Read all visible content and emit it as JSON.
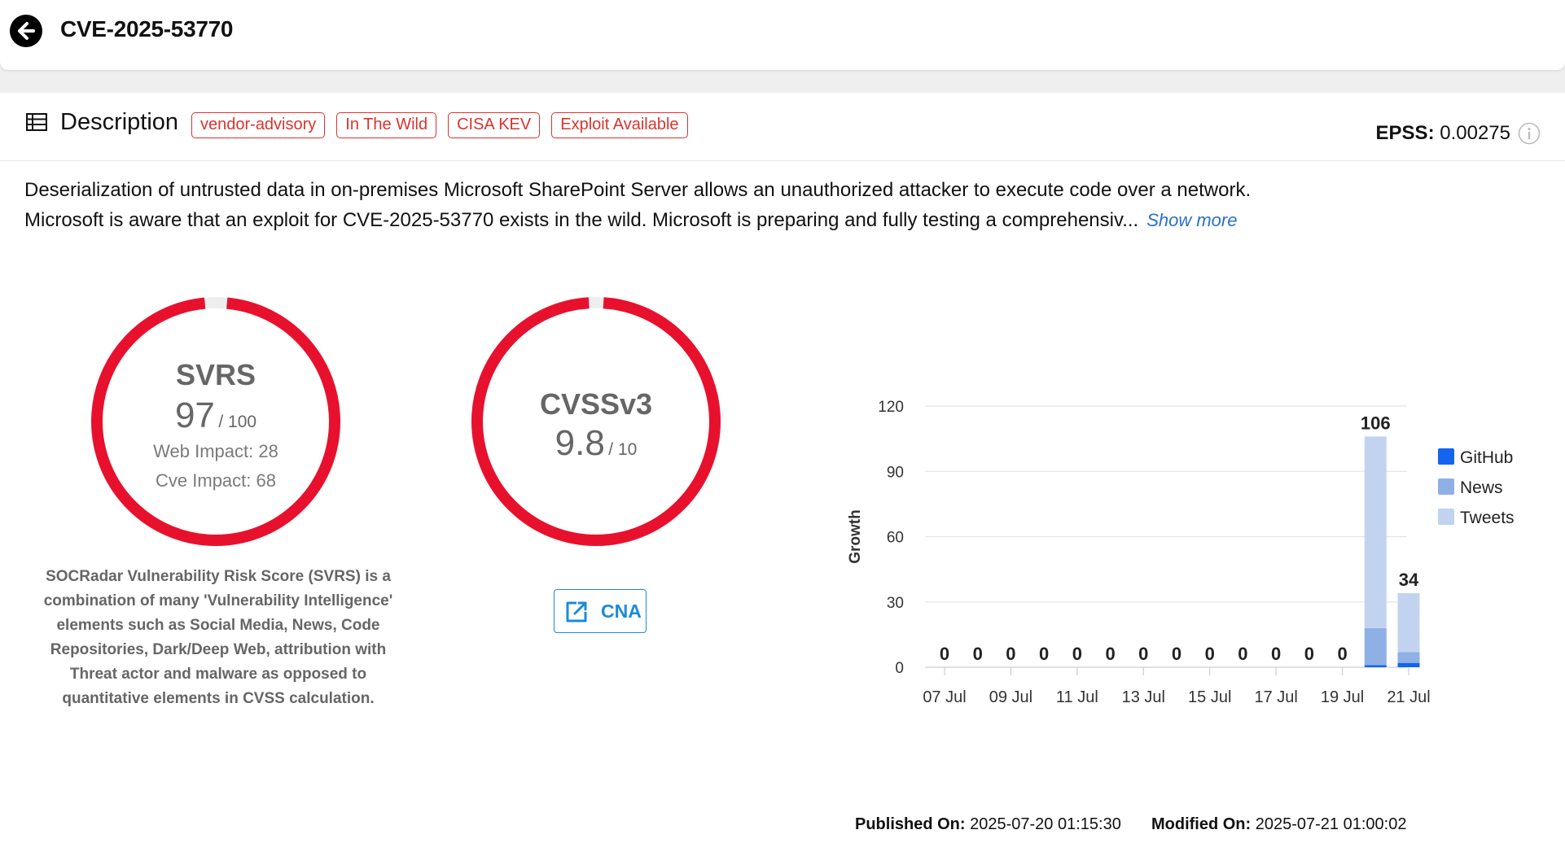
{
  "header": {
    "title": "CVE-2025-53770",
    "back_icon": "arrow-left-icon"
  },
  "description": {
    "heading": "Description",
    "tags": [
      "vendor-advisory",
      "In The Wild",
      "CISA KEV",
      "Exploit Available"
    ],
    "epss_label": "EPSS:",
    "epss_value": "0.00275",
    "text": "Deserialization of untrusted data in on-premises Microsoft SharePoint Server allows an unauthorized attacker to execute code over a network. Microsoft is aware that an exploit for CVE-2025-53770 exists in the wild. Microsoft is preparing and fully testing a comprehensiv...",
    "show_more": "Show more"
  },
  "svrs": {
    "title": "SVRS",
    "score": "97",
    "max": "/ 100",
    "fraction": 0.97,
    "web_impact": "Web Impact: 28",
    "cve_impact": "Cve Impact: 68",
    "note": "SOCRadar Vulnerability Risk Score (SVRS) is a combination of many 'Vulnerability Intelligence' elements such as Social Media, News, Code Repositories, Dark/Deep Web, attribution with Threat actor and malware as opposed to quantitative elements in CVSS calculation."
  },
  "cvss": {
    "title": "CVSSv3",
    "score": "9.8",
    "max": "/ 10",
    "fraction": 0.98,
    "cna_label": "CNA"
  },
  "colors": {
    "gauge_red": "#e8112d",
    "github": "#1464f0",
    "news": "#8fb0e4",
    "tweets": "#c1d3ee"
  },
  "chart_data": {
    "type": "bar",
    "stacked": true,
    "ylabel": "Growth",
    "ylim": [
      0,
      120
    ],
    "yticks": [
      0,
      30,
      60,
      90,
      120
    ],
    "categories": [
      "07 Jul",
      "08 Jul",
      "09 Jul",
      "10 Jul",
      "11 Jul",
      "12 Jul",
      "13 Jul",
      "14 Jul",
      "15 Jul",
      "16 Jul",
      "17 Jul",
      "18 Jul",
      "19 Jul",
      "20 Jul",
      "21 Jul"
    ],
    "tick_labels": [
      "07 Jul",
      "09 Jul",
      "11 Jul",
      "13 Jul",
      "15 Jul",
      "17 Jul",
      "19 Jul",
      "21 Jul"
    ],
    "series": [
      {
        "name": "GitHub",
        "values": [
          0,
          0,
          0,
          0,
          0,
          0,
          0,
          0,
          0,
          0,
          0,
          0,
          0,
          1,
          2
        ]
      },
      {
        "name": "News",
        "values": [
          0,
          0,
          0,
          0,
          0,
          0,
          0,
          0,
          0,
          0,
          0,
          0,
          0,
          17,
          5
        ]
      },
      {
        "name": "Tweets",
        "values": [
          0,
          0,
          0,
          0,
          0,
          0,
          0,
          0,
          0,
          0,
          0,
          0,
          0,
          88,
          27
        ]
      }
    ],
    "totals": [
      0,
      0,
      0,
      0,
      0,
      0,
      0,
      0,
      0,
      0,
      0,
      0,
      0,
      106,
      34
    ],
    "legend": "right",
    "grid": true
  },
  "footer": {
    "published_label": "Published On:",
    "published_value": "2025-07-20 01:15:30",
    "modified_label": "Modified On:",
    "modified_value": "2025-07-21 01:00:02"
  }
}
